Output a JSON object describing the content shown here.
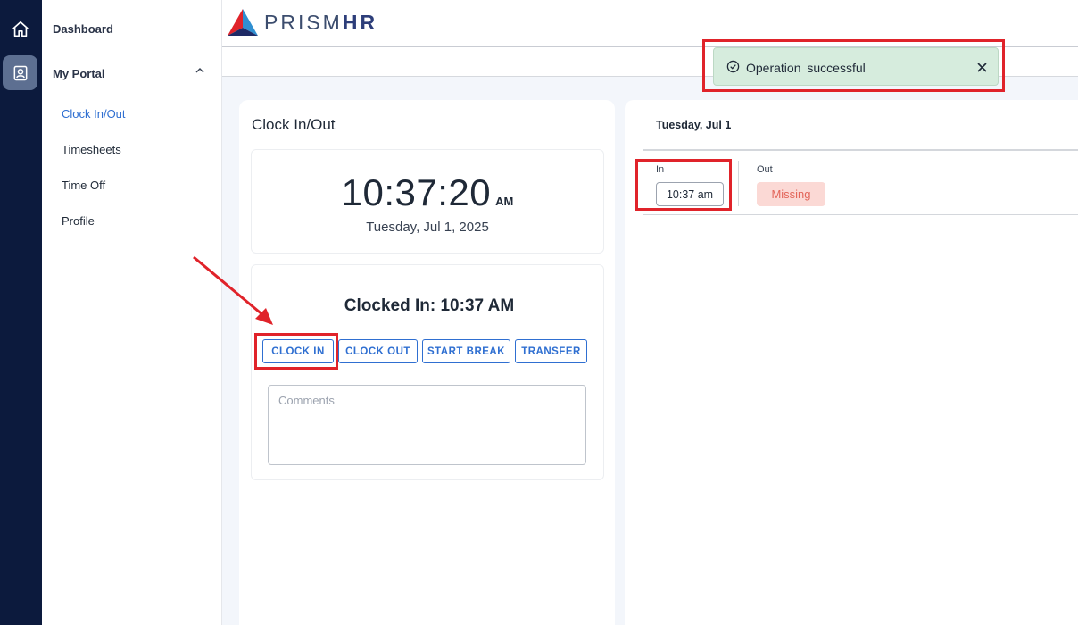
{
  "brand": {
    "logo_primary": "PRISM",
    "logo_bold": "HR"
  },
  "sidebar": {
    "dashboard": "Dashboard",
    "section": "My Portal",
    "items": [
      {
        "label": "Clock In/Out",
        "active": true
      },
      {
        "label": "Timesheets",
        "active": false
      },
      {
        "label": "Time Off",
        "active": false
      },
      {
        "label": "Profile",
        "active": false
      }
    ]
  },
  "toast": {
    "message": "Operation successful"
  },
  "clock_card": {
    "title": "Clock In/Out",
    "time": "10:37:20",
    "ampm": "AM",
    "date": "Tuesday, Jul 1, 2025",
    "status": "Clocked In: 10:37 AM",
    "buttons": {
      "clock_in": "CLOCK IN",
      "clock_out": "CLOCK OUT",
      "start_break": "START BREAK",
      "transfer": "TRANSFER"
    },
    "comments_placeholder": "Comments",
    "comments_value": ""
  },
  "day_card": {
    "title": "Tuesday, Jul 1",
    "in_label": "In",
    "in_value": "10:37 am",
    "out_label": "Out",
    "out_value": "Missing"
  },
  "colors": {
    "rail_bg": "#0c1a3d",
    "accent": "#2f6fd1",
    "success_bg": "#d6ecdd",
    "missing_bg": "#fbd9d5",
    "missing_text": "#e3665a",
    "annotation_red": "#e0232a"
  },
  "icons": {
    "rail_home": "home-icon",
    "rail_portal": "portal-badge-icon",
    "section_toggle": "chevron-up-icon",
    "toast_status": "check-circle-icon",
    "toast_close": "close-icon"
  }
}
